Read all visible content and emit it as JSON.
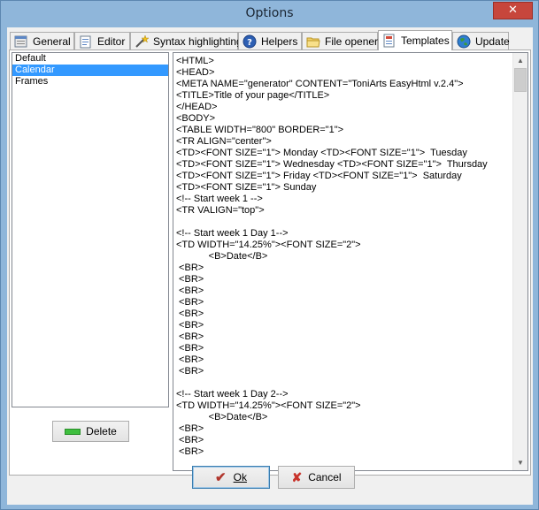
{
  "window": {
    "title": "Options",
    "close_glyph": "✕"
  },
  "tabs": [
    {
      "label": "General",
      "icon": "general-icon"
    },
    {
      "label": "Editor",
      "icon": "editor-icon"
    },
    {
      "label": "Syntax highlighting",
      "icon": "syntax-wand-icon"
    },
    {
      "label": "Helpers",
      "icon": "help-icon"
    },
    {
      "label": "File opener",
      "icon": "folder-icon"
    },
    {
      "label": "Templates",
      "icon": "templates-icon",
      "active": true
    },
    {
      "label": "Update",
      "icon": "globe-icon"
    }
  ],
  "templates": {
    "items": [
      "Default",
      "Calendar",
      "Frames"
    ],
    "selected": "Calendar",
    "delete_label": "Delete"
  },
  "editor": {
    "lines": [
      "<HTML>",
      "<HEAD>",
      "<META NAME=\"generator\" CONTENT=\"ToniArts EasyHtml v.2.4\">",
      "<TITLE>Title of your page</TITLE>",
      "</HEAD>",
      "<BODY>",
      "<TABLE WIDTH=\"800\" BORDER=\"1\">",
      "<TR ALIGN=\"center\">",
      "<TD><FONT SIZE=\"1\"> Monday <TD><FONT SIZE=\"1\">  Tuesday",
      "<TD><FONT SIZE=\"1\"> Wednesday <TD><FONT SIZE=\"1\">  Thursday",
      "<TD><FONT SIZE=\"1\"> Friday <TD><FONT SIZE=\"1\">  Saturday",
      "<TD><FONT SIZE=\"1\"> Sunday",
      "<!-- Start week 1 -->",
      "<TR VALIGN=\"top\">",
      "",
      "<!-- Start week 1 Day 1-->",
      "<TD WIDTH=\"14.25%\"><FONT SIZE=\"2\">",
      "            <B>Date</B>",
      " <BR>",
      " <BR>",
      " <BR>",
      " <BR>",
      " <BR>",
      " <BR>",
      " <BR>",
      " <BR>",
      " <BR>",
      " <BR>",
      "",
      "<!-- Start week 1 Day 2-->",
      "<TD WIDTH=\"14.25%\"><FONT SIZE=\"2\">",
      "            <B>Date</B>",
      " <BR>",
      " <BR>",
      " <BR>"
    ]
  },
  "buttons": {
    "ok_label": "Ok",
    "cancel_label": "Cancel"
  },
  "colors": {
    "title_bar": "#8fb6da",
    "close": "#c7463c",
    "selection": "#3399ff"
  }
}
